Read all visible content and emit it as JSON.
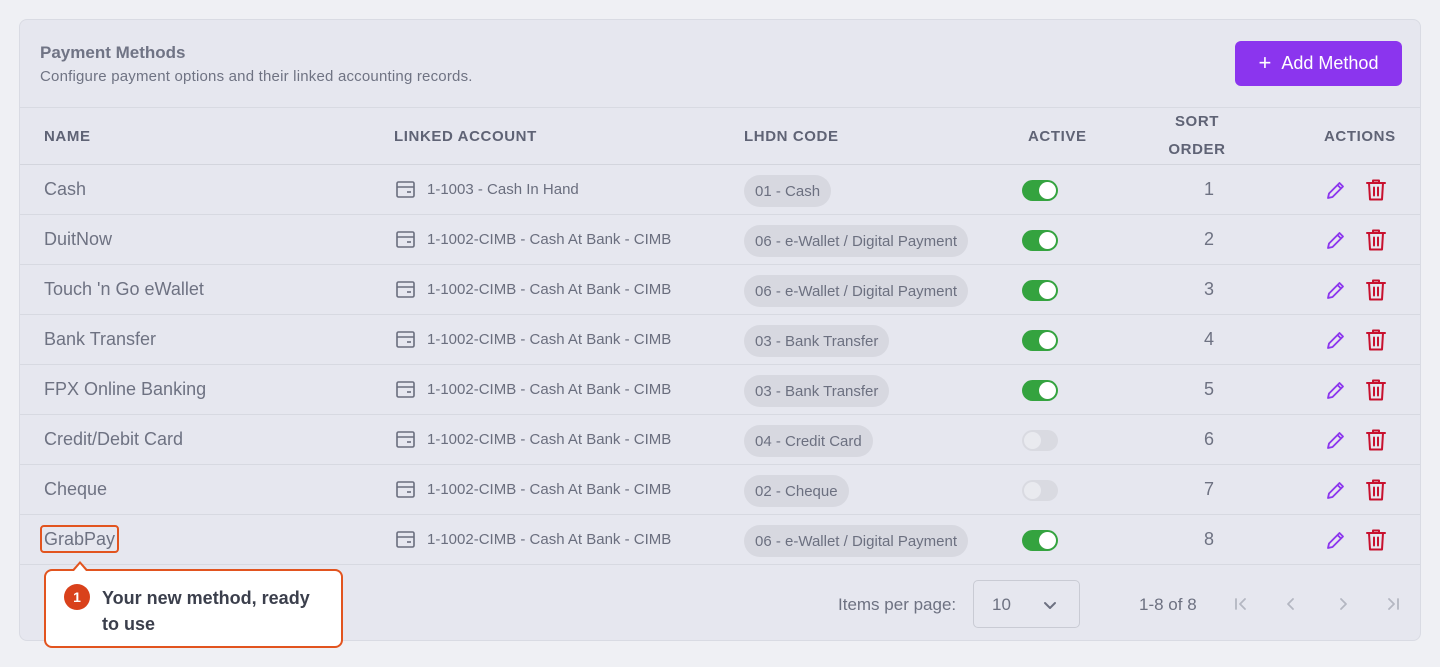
{
  "header": {
    "title": "Payment Methods",
    "subtitle": "Configure payment options and their linked accounting records.",
    "add_button": "Add Method",
    "add_icon": "+"
  },
  "columns": {
    "name": "NAME",
    "linked_account": "LINKED ACCOUNT",
    "lhdn_code": "LHDN CODE",
    "active": "ACTIVE",
    "sort_order_line1": "SORT",
    "sort_order_line2": "ORDER",
    "actions": "ACTIONS"
  },
  "rows": [
    {
      "name": "Cash",
      "account": "1-1003 - Cash In Hand",
      "lhdn": "01 - Cash",
      "active": true,
      "sort": "1"
    },
    {
      "name": "DuitNow",
      "account": "1-1002-CIMB - Cash At Bank - CIMB",
      "lhdn": "06 - e-Wallet / Digital Payment",
      "active": true,
      "sort": "2"
    },
    {
      "name": "Touch 'n Go eWallet",
      "account": "1-1002-CIMB - Cash At Bank - CIMB",
      "lhdn": "06 - e-Wallet / Digital Payment",
      "active": true,
      "sort": "3"
    },
    {
      "name": "Bank Transfer",
      "account": "1-1002-CIMB - Cash At Bank - CIMB",
      "lhdn": "03 - Bank Transfer",
      "active": true,
      "sort": "4"
    },
    {
      "name": "FPX Online Banking",
      "account": "1-1002-CIMB - Cash At Bank - CIMB",
      "lhdn": "03 - Bank Transfer",
      "active": true,
      "sort": "5"
    },
    {
      "name": "Credit/Debit Card",
      "account": "1-1002-CIMB - Cash At Bank - CIMB",
      "lhdn": "04 - Credit Card",
      "active": false,
      "sort": "6"
    },
    {
      "name": "Cheque",
      "account": "1-1002-CIMB - Cash At Bank - CIMB",
      "lhdn": "02 - Cheque",
      "active": false,
      "sort": "7"
    },
    {
      "name": "GrabPay",
      "account": "1-1002-CIMB - Cash At Bank - CIMB",
      "lhdn": "06 - e-Wallet / Digital Payment",
      "active": true,
      "sort": "8"
    }
  ],
  "pagination": {
    "items_per_page_label": "Items per page:",
    "items_per_page_value": "10",
    "range": "1-8 of 8"
  },
  "tooltip": {
    "step": "1",
    "text": "Your new method, ready to use"
  },
  "colors": {
    "primary": "#8b35ee",
    "toggle_on": "#34a33f",
    "edit_icon": "#8b35ee",
    "delete_icon": "#c8102e",
    "highlight": "#e2541f"
  }
}
